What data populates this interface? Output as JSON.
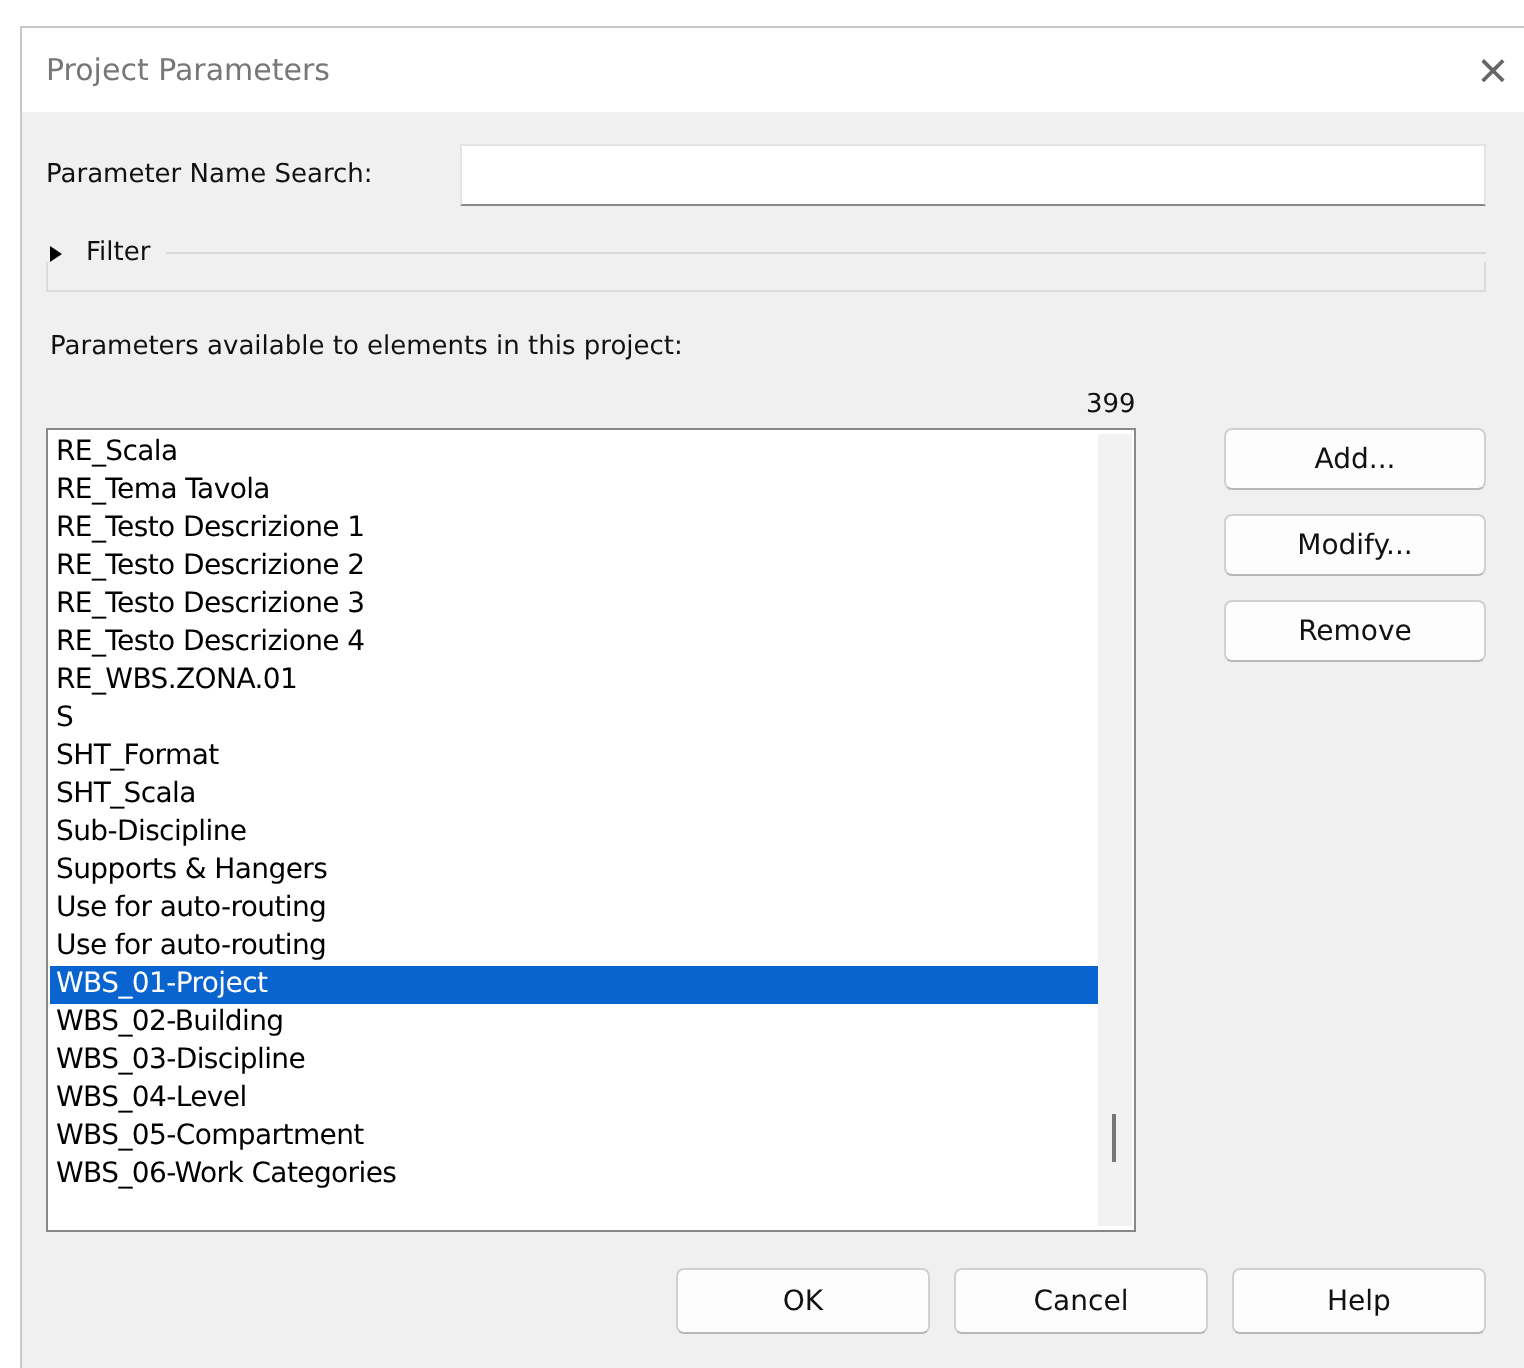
{
  "window": {
    "title": "Project Parameters",
    "close": "×"
  },
  "search": {
    "label": "Parameter Name Search:"
  },
  "filter": {
    "label": "Filter",
    "expanded": false
  },
  "list_label": "Parameters available to elements in this project:",
  "count": "399",
  "parameters": [
    {
      "name": "RE_Scala",
      "selected": false
    },
    {
      "name": "RE_Tema Tavola",
      "selected": false
    },
    {
      "name": "RE_Testo Descrizione 1",
      "selected": false
    },
    {
      "name": "RE_Testo Descrizione 2",
      "selected": false
    },
    {
      "name": "RE_Testo Descrizione 3",
      "selected": false
    },
    {
      "name": "RE_Testo Descrizione 4",
      "selected": false
    },
    {
      "name": "RE_WBS.ZONA.01",
      "selected": false
    },
    {
      "name": "S",
      "selected": false
    },
    {
      "name": "SHT_Format",
      "selected": false
    },
    {
      "name": "SHT_Scala",
      "selected": false
    },
    {
      "name": "Sub-Discipline",
      "selected": false
    },
    {
      "name": "Supports & Hangers",
      "selected": false
    },
    {
      "name": "Use for auto-routing",
      "selected": false
    },
    {
      "name": "Use for auto-routing",
      "selected": false
    },
    {
      "name": "WBS_01-Project",
      "selected": true
    },
    {
      "name": "WBS_02-Building",
      "selected": false
    },
    {
      "name": "WBS_03-Discipline",
      "selected": false
    },
    {
      "name": "WBS_04-Level",
      "selected": false
    },
    {
      "name": "WBS_05-Compartment",
      "selected": false
    },
    {
      "name": "WBS_06-Work Categories",
      "selected": false
    }
  ],
  "side_buttons": [
    "Add...",
    "Modify...",
    "Remove"
  ],
  "buttons": [
    "OK",
    "Cancel",
    "Help"
  ]
}
